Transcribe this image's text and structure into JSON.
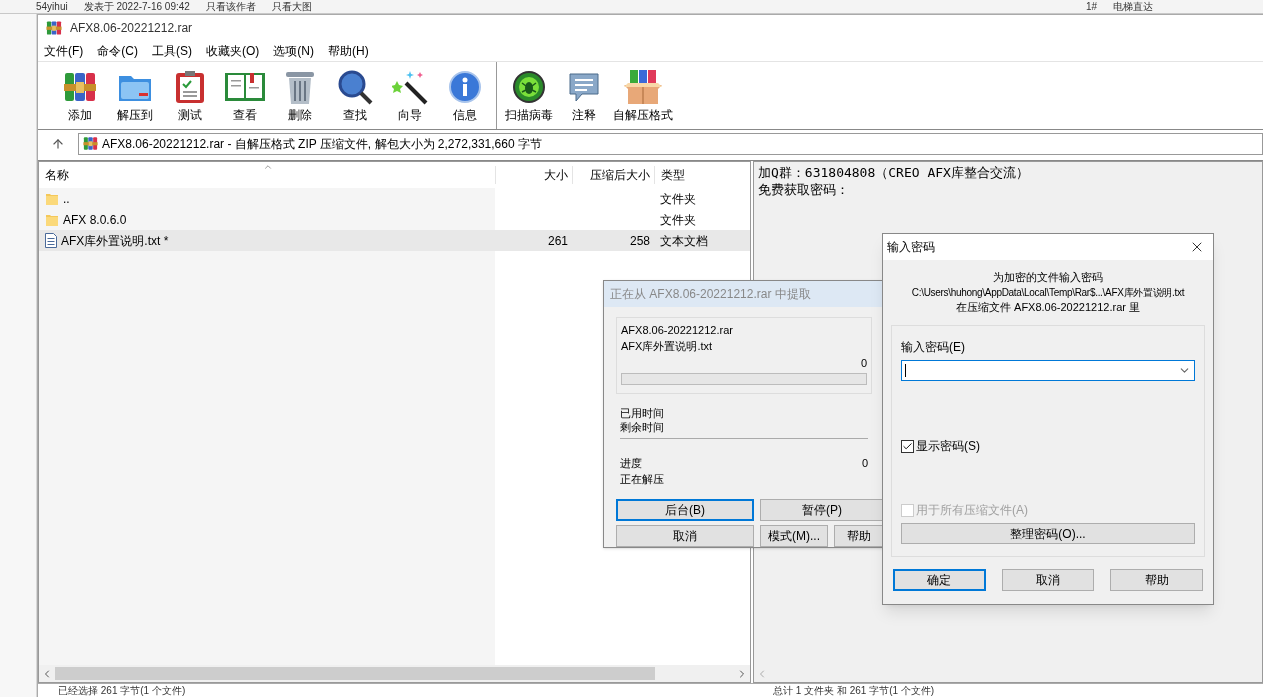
{
  "background_page": {
    "texts": [
      "54yihui",
      "发表于 2022-7-16 09:42",
      "只看该作者",
      "只看大图",
      "1#",
      "电梯直达"
    ]
  },
  "window": {
    "title": "AFX8.06-20221212.rar"
  },
  "menu": [
    "文件(F)",
    "命令(C)",
    "工具(S)",
    "收藏夹(O)",
    "选项(N)",
    "帮助(H)"
  ],
  "toolbar": {
    "groups": [
      [
        {
          "label": "添加"
        },
        {
          "label": "解压到"
        },
        {
          "label": "测试"
        },
        {
          "label": "查看"
        },
        {
          "label": "删除"
        },
        {
          "label": "查找"
        },
        {
          "label": "向导"
        },
        {
          "label": "信息"
        }
      ],
      [
        {
          "label": "扫描病毒"
        },
        {
          "label": "注释"
        },
        {
          "label": "自解压格式"
        }
      ]
    ]
  },
  "address_bar": {
    "text": "AFX8.06-20221212.rar - 自解压格式 ZIP 压缩文件, 解包大小为 2,272,331,660 字节"
  },
  "file_list": {
    "columns": [
      "名称",
      "大小",
      "压缩后大小",
      "类型"
    ],
    "rows": [
      {
        "kind": "folder",
        "name": "..",
        "type": "文件夹",
        "selected": false
      },
      {
        "kind": "folder",
        "name": "AFX 8.0.6.0",
        "type": "文件夹",
        "selected": false
      },
      {
        "kind": "file",
        "name": "AFX库外置说明.txt *",
        "size": "261",
        "packed": "258",
        "type": "文本文档",
        "selected": true
      }
    ]
  },
  "comment": {
    "lines": [
      "加Q群：631804808（CREO AFX库整合交流）",
      "免费获取密码："
    ]
  },
  "extract_dialog": {
    "title": "正在从 AFX8.06-20221212.rar 中提取",
    "archive": "AFX8.06-20221212.rar",
    "file": "AFX库外置说明.txt",
    "file_percent": "0",
    "level": 0,
    "elapsed_label": "已用时间",
    "remaining_label": "剩余时间",
    "progress_label": "进度",
    "status": "正在解压",
    "total_percent": "0",
    "buttons": [
      {
        "label": "后台(B)",
        "focused": true
      },
      {
        "label": "暂停(P)",
        "focused": false
      },
      {
        "label": "取消",
        "focused": false
      },
      {
        "label": "模式(M)...",
        "focused": false
      },
      {
        "label": "帮助",
        "focused": false
      }
    ]
  },
  "password_dialog": {
    "title": "输入密码",
    "heading": "为加密的文件输入密码",
    "path": "C:\\Users\\huhong\\AppData\\Local\\Temp\\Rar$...\\AFX库外置说明.txt",
    "archive_line": "在压缩文件 AFX8.06-20221212.rar 里",
    "field_label": "输入密码(E)",
    "options": [
      {
        "label": "显示密码(S)",
        "checked": true,
        "disabled": false
      },
      {
        "label": "用于所有压缩文件(A)",
        "checked": false,
        "disabled": true
      }
    ],
    "organize_button": "整理密码(O)...",
    "buttons": [
      {
        "label": "确定",
        "focused": true
      },
      {
        "label": "取消",
        "focused": false
      },
      {
        "label": "帮助",
        "focused": false
      }
    ]
  },
  "status_bar": {
    "left": "已经选择 261 字节(1 个文件)",
    "right": "总计 1 文件夹 和 261 字节(1 个文件)"
  }
}
